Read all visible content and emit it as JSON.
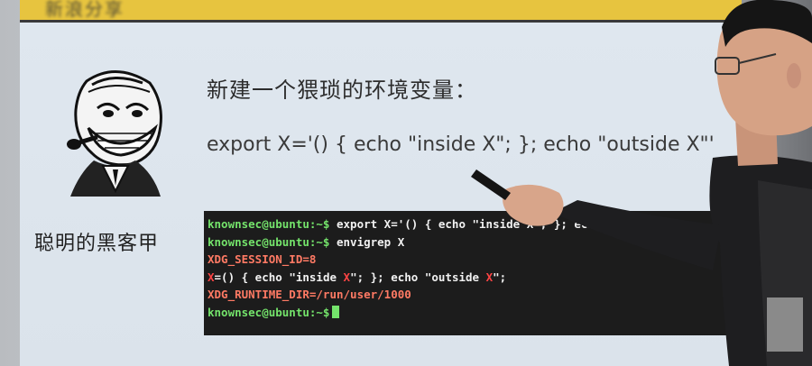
{
  "slide": {
    "header_title": "新浪分享",
    "heading": "新建一个猥琐的环境变量：",
    "command": "export X='() { echo \"inside X\"; }; echo \"outside X\"'",
    "caption": "聪明的黑客甲"
  },
  "terminal": {
    "lines": [
      {
        "prompt": "knownsec@ubuntu:~$",
        "text": " export X='() { echo \"inside X\"; }; echo \"out"
      },
      {
        "prompt": "knownsec@ubuntu:~$",
        "text": " envigrep X"
      },
      {
        "env": "XDG_SESSION_ID=8"
      },
      {
        "x": "X",
        "text_a": "=() { echo \"inside ",
        "x2": "X",
        "text_b": "\"; }; echo \"outside ",
        "x3": "X",
        "text_c": "\";"
      },
      {
        "env": "XDG_RUNTIME_DIR=/run/user/1000"
      },
      {
        "prompt": "knownsec@ubuntu:~$",
        "text": ""
      }
    ]
  },
  "colors": {
    "header": "#e7c43f",
    "prompt": "#74e36b",
    "env": "#ff7a64",
    "terminal_bg": "#1c1c1c"
  }
}
